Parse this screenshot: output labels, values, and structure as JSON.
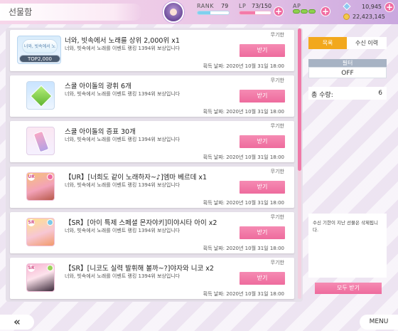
{
  "header": {
    "title": "선물함",
    "rank_label": "RANK",
    "rank_value": "79",
    "rank_progress": 0.4,
    "lp_label": "LP",
    "lp_value": "73/150",
    "lp_progress": 0.49,
    "ap_label": "AP",
    "ap_count": 3,
    "gem_count": "10,945",
    "gold_count": "22,423,145",
    "plus_label": "+"
  },
  "gifts": [
    {
      "name": "너와, 빗속에서 노래를 상위 2,000위 x1",
      "desc": "너와, 빗속에서 노래를 이벤트 랭킹 1394위 보상입니다",
      "expiry": "무기한",
      "button": "받기",
      "date": "획득 날짜: 2020년 10월 31일 18:00",
      "thumb": "title-badge",
      "badge_text": "TOP2,000"
    },
    {
      "name": "스쿨 아이돌의 광휘 6개",
      "desc": "너와, 빗속에서 노래를 이벤트 랭킹 1394위 보상입니다",
      "expiry": "무기한",
      "button": "받기",
      "date": "획득 날짜: 2020년 10월 31일 18:00",
      "thumb": "green-gem"
    },
    {
      "name": "스쿨 아이돌의 증표 30개",
      "desc": "너와, 빗속에서 노래를 이벤트 랭킹 1394위 보상입니다",
      "expiry": "무기한",
      "button": "받기",
      "date": "획득 날짜: 2020년 10월 31일 18:00",
      "thumb": "ticket"
    },
    {
      "name": "【UR】[너희도 같이 노래하자~♪]엠마 베르데 x1",
      "desc": "너와, 빗속에서 노래를 이벤트 랭킹 1394위 보상입니다",
      "expiry": "무기한",
      "button": "받기",
      "date": "획득 날짜: 2020년 10월 31일 18:00",
      "thumb": "card",
      "rarity": "UR"
    },
    {
      "name": "【SR】[아이 특제 스페셜 몬자야키]미야시타 아이 x2",
      "desc": "너와, 빗속에서 노래를 이벤트 랭킹 1394위 보상입니다",
      "expiry": "무기한",
      "button": "받기",
      "date": "획득 날짜: 2020년 10월 31일 18:00",
      "thumb": "card",
      "rarity": "SR"
    },
    {
      "name": "【SR】[니코도 실력 발휘해 볼까~?]야자와 니코 x2",
      "desc": "너와, 빗속에서 노래를 이벤트 랭킹 1394위 보상입니다",
      "expiry": "무기한",
      "button": "받기",
      "date": "획득 날짜: 2020년 10월 31일 18:00",
      "thumb": "card",
      "rarity": "SR"
    }
  ],
  "sidebar": {
    "tab_active": "목록",
    "tab_inactive": "수신 이력",
    "filter_label": "필터",
    "filter_value": "OFF",
    "total_label": "총 수량:",
    "total_value": "6",
    "notice": "수신 기한이 지난 선물은 삭제됩니다.",
    "receive_all": "모두 받기"
  },
  "footer": {
    "back_label": "«",
    "menu_label": "MENU"
  },
  "colors": {
    "accent_pink": "#ee6b9d",
    "tab_orange": "#f2a81d",
    "filter_gray": "#a7b3c4"
  }
}
